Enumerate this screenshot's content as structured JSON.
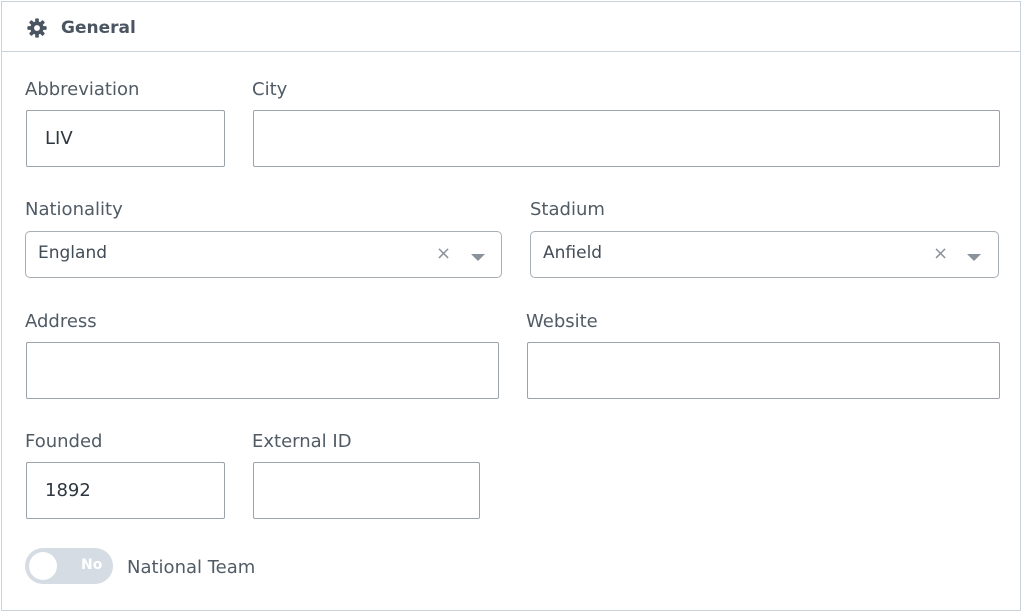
{
  "panel": {
    "title": "General",
    "icon": "gear-icon"
  },
  "fields": {
    "abbreviation": {
      "label": "Abbreviation",
      "value": "LIV"
    },
    "city": {
      "label": "City",
      "value": ""
    },
    "nationality": {
      "label": "Nationality",
      "value": "England",
      "clear": "×"
    },
    "stadium": {
      "label": "Stadium",
      "value": "Anfield",
      "clear": "×"
    },
    "address": {
      "label": "Address",
      "value": ""
    },
    "website": {
      "label": "Website",
      "value": ""
    },
    "founded": {
      "label": "Founded",
      "value": "1892"
    },
    "external_id": {
      "label": "External ID",
      "value": ""
    }
  },
  "national_team": {
    "label": "National Team",
    "toggle_text": "No",
    "enabled": false
  },
  "colors": {
    "border": "#c9d1da",
    "toggle_off": "#d5dce4",
    "text": "#505b66"
  }
}
